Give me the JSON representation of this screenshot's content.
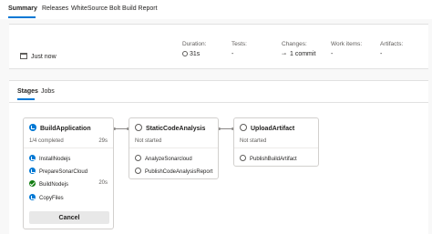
{
  "tabs": [
    {
      "label": "Summary",
      "active": true
    },
    {
      "label": "Releases",
      "active": false
    },
    {
      "label": "WhiteSource Bolt Build Report",
      "active": false
    }
  ],
  "summary": {
    "when": "Just now",
    "duration": {
      "label": "Duration:",
      "value": "31s"
    },
    "tests": {
      "label": "Tests:",
      "value": "-"
    },
    "changes": {
      "label": "Changes:",
      "value": "1 commit"
    },
    "work_items": {
      "label": "Work items:",
      "value": "-"
    },
    "artifacts": {
      "label": "Artifacts:",
      "value": "-"
    }
  },
  "sub_tabs": [
    {
      "label": "Stages",
      "active": true
    },
    {
      "label": "Jobs",
      "active": false
    }
  ],
  "stages": [
    {
      "name": "BuildApplication",
      "status": "1/4 completed",
      "duration": "29s",
      "jobs": [
        {
          "name": "InstallNodejs",
          "state": "running",
          "duration": ""
        },
        {
          "name": "PrepareSonarCloud",
          "state": "running",
          "duration": ""
        },
        {
          "name": "BuildNodejs",
          "state": "succeeded",
          "duration": "20s"
        },
        {
          "name": "CopyFiles",
          "state": "running",
          "duration": ""
        }
      ],
      "cancel_label": "Cancel"
    },
    {
      "name": "StaticCodeAnalysis",
      "status": "Not started",
      "jobs": [
        {
          "name": "AnalyzeSonarcloud",
          "state": "pending"
        },
        {
          "name": "PublishCodeAnalysisReport",
          "state": "pending"
        }
      ]
    },
    {
      "name": "UploadArtifact",
      "status": "Not started",
      "jobs": [
        {
          "name": "PublishBuildArtifact",
          "state": "pending"
        }
      ]
    }
  ],
  "colors": {
    "accent": "#0078d4",
    "success": "#107c10",
    "pending": "#605e5c"
  }
}
